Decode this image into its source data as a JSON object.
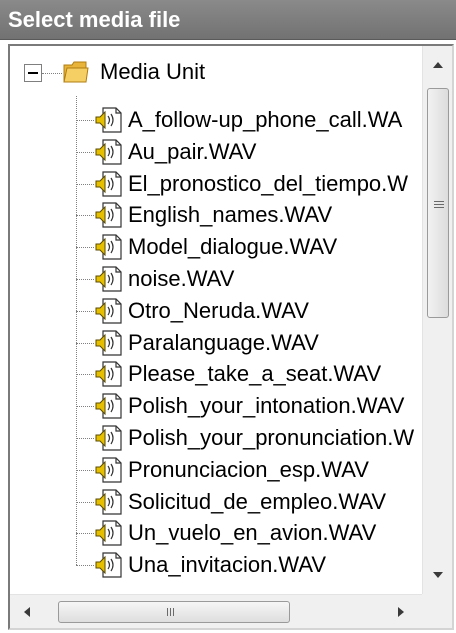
{
  "header": {
    "title": "Select media file"
  },
  "tree": {
    "root": {
      "label": "Media Unit",
      "icon": "folder-icon"
    },
    "files": [
      "A_follow-up_phone_call.WA",
      "Au_pair.WAV",
      "El_pronostico_del_tiempo.W",
      "English_names.WAV",
      "Model_dialogue.WAV",
      "noise.WAV",
      "Otro_Neruda.WAV",
      "Paralanguage.WAV",
      "Please_take_a_seat.WAV",
      "Polish_your_intonation.WAV",
      "Polish_your_pronunciation.W",
      "Pronunciacion_esp.WAV",
      "Solicitud_de_empleo.WAV",
      "Un_vuelo_en_avion.WAV",
      "Una_invitacion.WAV"
    ],
    "file_icon": "audio-file-icon"
  },
  "scrollbars": {
    "vertical": {
      "position": 0.05
    },
    "horizontal": {
      "position": 0.0
    }
  },
  "colors": {
    "header_bg": "#7f7f7f",
    "header_text": "#ffffff"
  }
}
